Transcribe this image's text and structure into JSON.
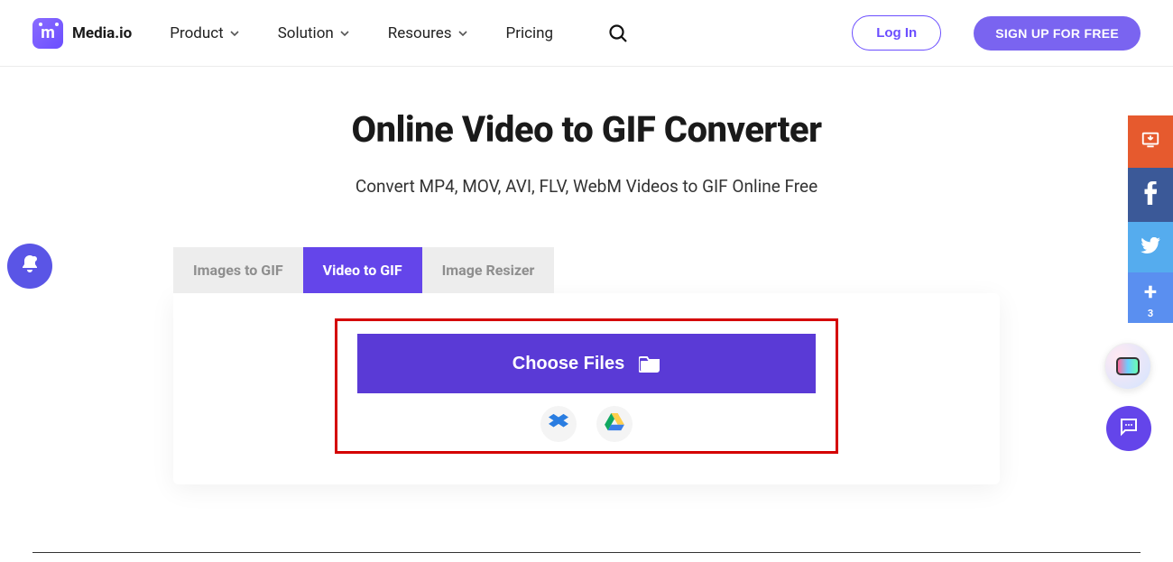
{
  "brand": {
    "name": "Media.io",
    "logo_letter": "m"
  },
  "nav": {
    "items": [
      {
        "label": "Product",
        "hasChevron": true
      },
      {
        "label": "Solution",
        "hasChevron": true
      },
      {
        "label": "Resoures",
        "hasChevron": true
      },
      {
        "label": "Pricing",
        "hasChevron": false
      }
    ]
  },
  "header_buttons": {
    "login": "Log In",
    "signup": "SIGN UP FOR FREE"
  },
  "page": {
    "title": "Online Video to GIF Converter",
    "subtitle": "Convert MP4, MOV, AVI, FLV, WebM Videos to GIF Online Free"
  },
  "tabs": [
    {
      "label": "Images to GIF",
      "active": false
    },
    {
      "label": "Video to GIF",
      "active": true
    },
    {
      "label": "Image Resizer",
      "active": false
    }
  ],
  "uploader": {
    "choose_label": "Choose Files",
    "cloud": [
      {
        "name": "dropbox"
      },
      {
        "name": "google-drive"
      }
    ]
  },
  "share_bar": {
    "more_count": "3"
  }
}
